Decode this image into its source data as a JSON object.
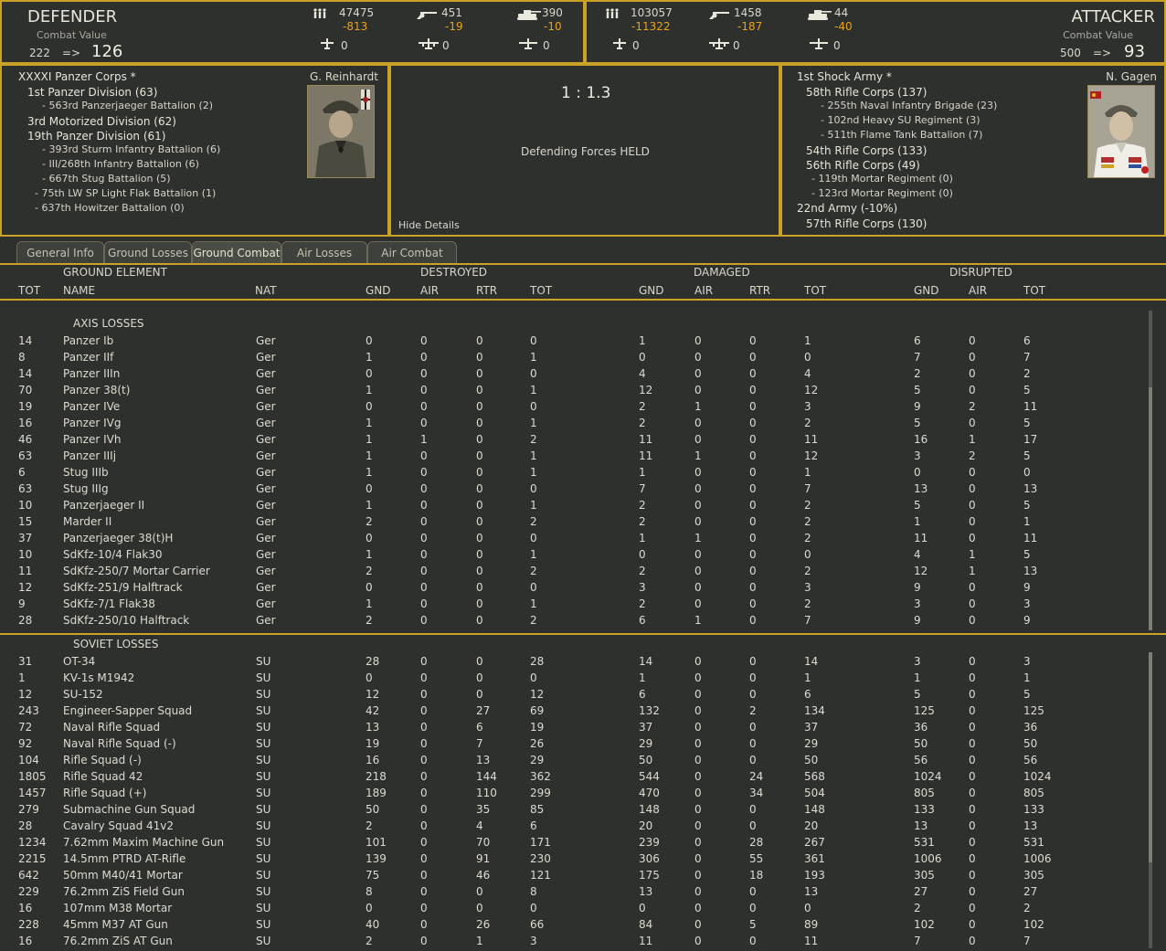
{
  "defender": {
    "title": "DEFENDER",
    "combat_value_label": "Combat Value",
    "cv_before": "222",
    "arrow": "=>",
    "cv_after": "126",
    "men": "47475",
    "men_delta": "-813",
    "guns": "451",
    "guns_delta": "-19",
    "tanks": "390",
    "tanks_delta": "-10",
    "air1": "0",
    "air2": "0",
    "air3": "0"
  },
  "attacker": {
    "title": "ATTACKER",
    "combat_value_label": "Combat Value",
    "cv_before": "500",
    "arrow": "=>",
    "cv_after": "93",
    "men": "103057",
    "men_delta": "-11322",
    "guns": "1458",
    "guns_delta": "-187",
    "tanks": "44",
    "tanks_delta": "-40",
    "air1": "0",
    "air2": "0",
    "air3": "0"
  },
  "defender_oob": {
    "commander": "G. Reinhardt",
    "units": [
      {
        "text": "XXXXI Panzer Corps *",
        "level": 0
      },
      {
        "text": "1st Panzer Division (63)",
        "level": 1
      },
      {
        "text": "- 563rd Panzerjaeger Battalion (2)",
        "level": 2
      },
      {
        "text": "3rd Motorized Division (62)",
        "level": 1
      },
      {
        "text": "19th Panzer Division (61)",
        "level": 1
      },
      {
        "text": "- 393rd Sturm Infantry Battalion (6)",
        "level": 2
      },
      {
        "text": "- III/268th Infantry Battalion (6)",
        "level": 2
      },
      {
        "text": "- 667th Stug Battalion (5)",
        "level": 2
      },
      {
        "text": "- 75th LW SP Light Flak Battalion (1)",
        "level": 3
      },
      {
        "text": "- 637th Howitzer Battalion (0)",
        "level": 3
      }
    ]
  },
  "attacker_oob": {
    "commander": "N. Gagen",
    "units": [
      {
        "text": "1st Shock Army *",
        "level": 0
      },
      {
        "text": "58th Rifle Corps (137)",
        "level": 1
      },
      {
        "text": "- 255th Naval Infantry Brigade (23)",
        "level": 2
      },
      {
        "text": "- 102nd Heavy SU Regiment (3)",
        "level": 2
      },
      {
        "text": "- 511th Flame Tank Battalion (7)",
        "level": 2
      },
      {
        "text": "54th Rifle Corps (133)",
        "level": 1
      },
      {
        "text": "56th Rifle Corps (49)",
        "level": 1
      },
      {
        "text": "- 119th Mortar Regiment (0)",
        "level": 3
      },
      {
        "text": "- 123rd Mortar Regiment (0)",
        "level": 3
      },
      {
        "text": "22nd Army (-10%)",
        "level": 0
      },
      {
        "text": "57th Rifle Corps (130)",
        "level": 1
      }
    ]
  },
  "result": {
    "odds": "1 : 1.3",
    "outcome": "Defending Forces HELD",
    "hide_details": "Hide Details"
  },
  "tabs": [
    "General Info",
    "Ground Losses",
    "Ground Combat",
    "Air Losses",
    "Air Combat"
  ],
  "table_header": {
    "ground_element": "GROUND ELEMENT",
    "destroyed": "DESTROYED",
    "damaged": "DAMAGED",
    "disrupted": "DISRUPTED",
    "cols": [
      "TOT",
      "NAME",
      "NAT",
      "GND",
      "AIR",
      "RTR",
      "TOT",
      "GND",
      "AIR",
      "RTR",
      "TOT",
      "GND",
      "AIR",
      "TOT"
    ]
  },
  "axis_title": "AXIS LOSSES",
  "axis_rows": [
    [
      "14",
      "Panzer Ib",
      "Ger",
      "0",
      "0",
      "0",
      "0",
      "1",
      "0",
      "0",
      "1",
      "6",
      "0",
      "6"
    ],
    [
      "8",
      "Panzer IIf",
      "Ger",
      "1",
      "0",
      "0",
      "1",
      "0",
      "0",
      "0",
      "0",
      "7",
      "0",
      "7"
    ],
    [
      "14",
      "Panzer IIIn",
      "Ger",
      "0",
      "0",
      "0",
      "0",
      "4",
      "0",
      "0",
      "4",
      "2",
      "0",
      "2"
    ],
    [
      "70",
      "Panzer 38(t)",
      "Ger",
      "1",
      "0",
      "0",
      "1",
      "12",
      "0",
      "0",
      "12",
      "5",
      "0",
      "5"
    ],
    [
      "19",
      "Panzer IVe",
      "Ger",
      "0",
      "0",
      "0",
      "0",
      "2",
      "1",
      "0",
      "3",
      "9",
      "2",
      "11"
    ],
    [
      "16",
      "Panzer IVg",
      "Ger",
      "1",
      "0",
      "0",
      "1",
      "2",
      "0",
      "0",
      "2",
      "5",
      "0",
      "5"
    ],
    [
      "46",
      "Panzer IVh",
      "Ger",
      "1",
      "1",
      "0",
      "2",
      "11",
      "0",
      "0",
      "11",
      "16",
      "1",
      "17"
    ],
    [
      "63",
      "Panzer IIIj",
      "Ger",
      "1",
      "0",
      "0",
      "1",
      "11",
      "1",
      "0",
      "12",
      "3",
      "2",
      "5"
    ],
    [
      "6",
      "Stug IIIb",
      "Ger",
      "1",
      "0",
      "0",
      "1",
      "1",
      "0",
      "0",
      "1",
      "0",
      "0",
      "0"
    ],
    [
      "63",
      "Stug IIIg",
      "Ger",
      "0",
      "0",
      "0",
      "0",
      "7",
      "0",
      "0",
      "7",
      "13",
      "0",
      "13"
    ],
    [
      "10",
      "Panzerjaeger II",
      "Ger",
      "1",
      "0",
      "0",
      "1",
      "2",
      "0",
      "0",
      "2",
      "5",
      "0",
      "5"
    ],
    [
      "15",
      "Marder II",
      "Ger",
      "2",
      "0",
      "0",
      "2",
      "2",
      "0",
      "0",
      "2",
      "1",
      "0",
      "1"
    ],
    [
      "37",
      "Panzerjaeger 38(t)H",
      "Ger",
      "0",
      "0",
      "0",
      "0",
      "1",
      "1",
      "0",
      "2",
      "11",
      "0",
      "11"
    ],
    [
      "10",
      "SdKfz-10/4 Flak30",
      "Ger",
      "1",
      "0",
      "0",
      "1",
      "0",
      "0",
      "0",
      "0",
      "4",
      "1",
      "5"
    ],
    [
      "11",
      "SdKfz-250/7 Mortar Carrier",
      "Ger",
      "2",
      "0",
      "0",
      "2",
      "2",
      "0",
      "0",
      "2",
      "12",
      "1",
      "13"
    ],
    [
      "12",
      "SdKfz-251/9 Halftrack",
      "Ger",
      "0",
      "0",
      "0",
      "0",
      "3",
      "0",
      "0",
      "3",
      "9",
      "0",
      "9"
    ],
    [
      "9",
      "SdKfz-7/1 Flak38",
      "Ger",
      "1",
      "0",
      "0",
      "1",
      "2",
      "0",
      "0",
      "2",
      "3",
      "0",
      "3"
    ],
    [
      "28",
      "SdKfz-250/10 Halftrack",
      "Ger",
      "2",
      "0",
      "0",
      "2",
      "6",
      "1",
      "0",
      "7",
      "9",
      "0",
      "9"
    ]
  ],
  "soviet_title": "SOVIET LOSSES",
  "soviet_rows": [
    [
      "31",
      "OT-34",
      "SU",
      "28",
      "0",
      "0",
      "28",
      "14",
      "0",
      "0",
      "14",
      "3",
      "0",
      "3"
    ],
    [
      "1",
      "KV-1s M1942",
      "SU",
      "0",
      "0",
      "0",
      "0",
      "1",
      "0",
      "0",
      "1",
      "1",
      "0",
      "1"
    ],
    [
      "12",
      "SU-152",
      "SU",
      "12",
      "0",
      "0",
      "12",
      "6",
      "0",
      "0",
      "6",
      "5",
      "0",
      "5"
    ],
    [
      "243",
      "Engineer-Sapper Squad",
      "SU",
      "42",
      "0",
      "27",
      "69",
      "132",
      "0",
      "2",
      "134",
      "125",
      "0",
      "125"
    ],
    [
      "72",
      "Naval Rifle Squad",
      "SU",
      "13",
      "0",
      "6",
      "19",
      "37",
      "0",
      "0",
      "37",
      "36",
      "0",
      "36"
    ],
    [
      "92",
      "Naval Rifle Squad (-)",
      "SU",
      "19",
      "0",
      "7",
      "26",
      "29",
      "0",
      "0",
      "29",
      "50",
      "0",
      "50"
    ],
    [
      "104",
      "Rifle Squad (-)",
      "SU",
      "16",
      "0",
      "13",
      "29",
      "50",
      "0",
      "0",
      "50",
      "56",
      "0",
      "56"
    ],
    [
      "1805",
      "Rifle Squad 42",
      "SU",
      "218",
      "0",
      "144",
      "362",
      "544",
      "0",
      "24",
      "568",
      "1024",
      "0",
      "1024"
    ],
    [
      "1457",
      "Rifle Squad (+)",
      "SU",
      "189",
      "0",
      "110",
      "299",
      "470",
      "0",
      "34",
      "504",
      "805",
      "0",
      "805"
    ],
    [
      "279",
      "Submachine Gun Squad",
      "SU",
      "50",
      "0",
      "35",
      "85",
      "148",
      "0",
      "0",
      "148",
      "133",
      "0",
      "133"
    ],
    [
      "28",
      "Cavalry Squad 41v2",
      "SU",
      "2",
      "0",
      "4",
      "6",
      "20",
      "0",
      "0",
      "20",
      "13",
      "0",
      "13"
    ],
    [
      "1234",
      "7.62mm Maxim Machine Gun",
      "SU",
      "101",
      "0",
      "70",
      "171",
      "239",
      "0",
      "28",
      "267",
      "531",
      "0",
      "531"
    ],
    [
      "2215",
      "14.5mm PTRD AT-Rifle",
      "SU",
      "139",
      "0",
      "91",
      "230",
      "306",
      "0",
      "55",
      "361",
      "1006",
      "0",
      "1006"
    ],
    [
      "642",
      "50mm M40/41 Mortar",
      "SU",
      "75",
      "0",
      "46",
      "121",
      "175",
      "0",
      "18",
      "193",
      "305",
      "0",
      "305"
    ],
    [
      "229",
      "76.2mm ZiS Field Gun",
      "SU",
      "8",
      "0",
      "0",
      "8",
      "13",
      "0",
      "0",
      "13",
      "27",
      "0",
      "27"
    ],
    [
      "16",
      "107mm M38 Mortar",
      "SU",
      "0",
      "0",
      "0",
      "0",
      "0",
      "0",
      "0",
      "0",
      "2",
      "0",
      "2"
    ],
    [
      "228",
      "45mm M37 AT Gun",
      "SU",
      "40",
      "0",
      "26",
      "66",
      "84",
      "0",
      "5",
      "89",
      "102",
      "0",
      "102"
    ],
    [
      "16",
      "76.2mm ZiS AT Gun",
      "SU",
      "2",
      "0",
      "1",
      "3",
      "11",
      "0",
      "0",
      "11",
      "7",
      "0",
      "7"
    ]
  ]
}
